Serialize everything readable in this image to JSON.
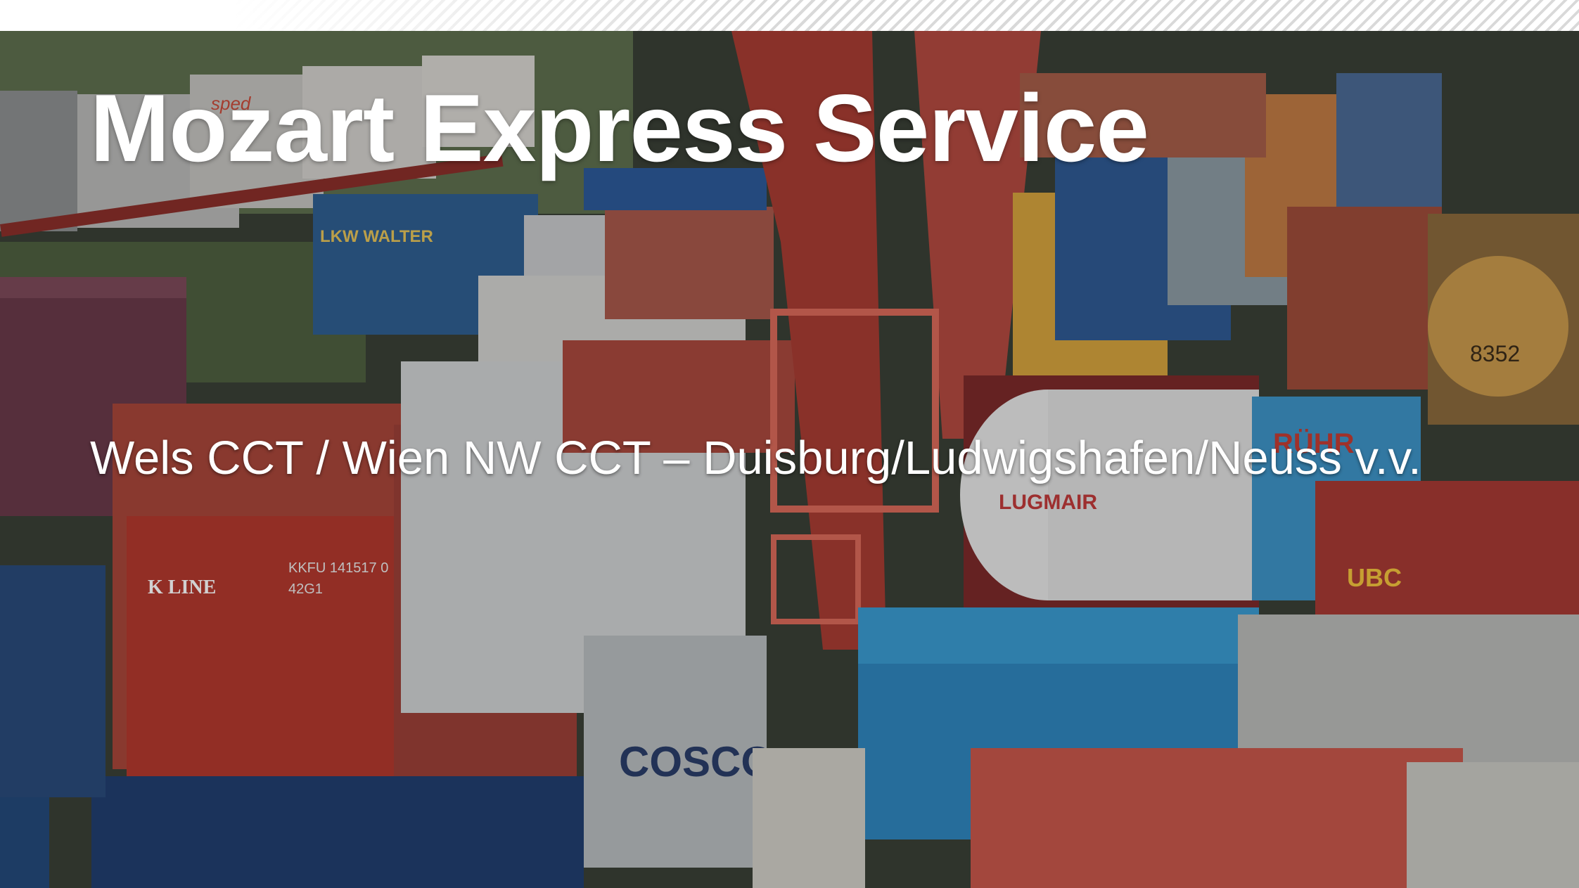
{
  "slide": {
    "title": "Mozart Express Service",
    "subtitle": "Wels CCT / Wien NW CCT – Duisburg/Ludwigshafen/Neuss v.v."
  },
  "background_photo": {
    "subject": "container-terminal-photo",
    "container_markings": [
      "K LINE",
      "KKFU 141517 0",
      "42G1",
      "COSCO",
      "UBC",
      "LUGMAIR",
      "RÜHR",
      "8352",
      "LKW WALTER",
      "sped"
    ]
  },
  "colors": {
    "title_text": "#ffffff",
    "container_red": "#a8392c",
    "container_blue": "#1f4d86",
    "crane_red": "#b0463c",
    "container_yellow": "#d8a63a"
  }
}
